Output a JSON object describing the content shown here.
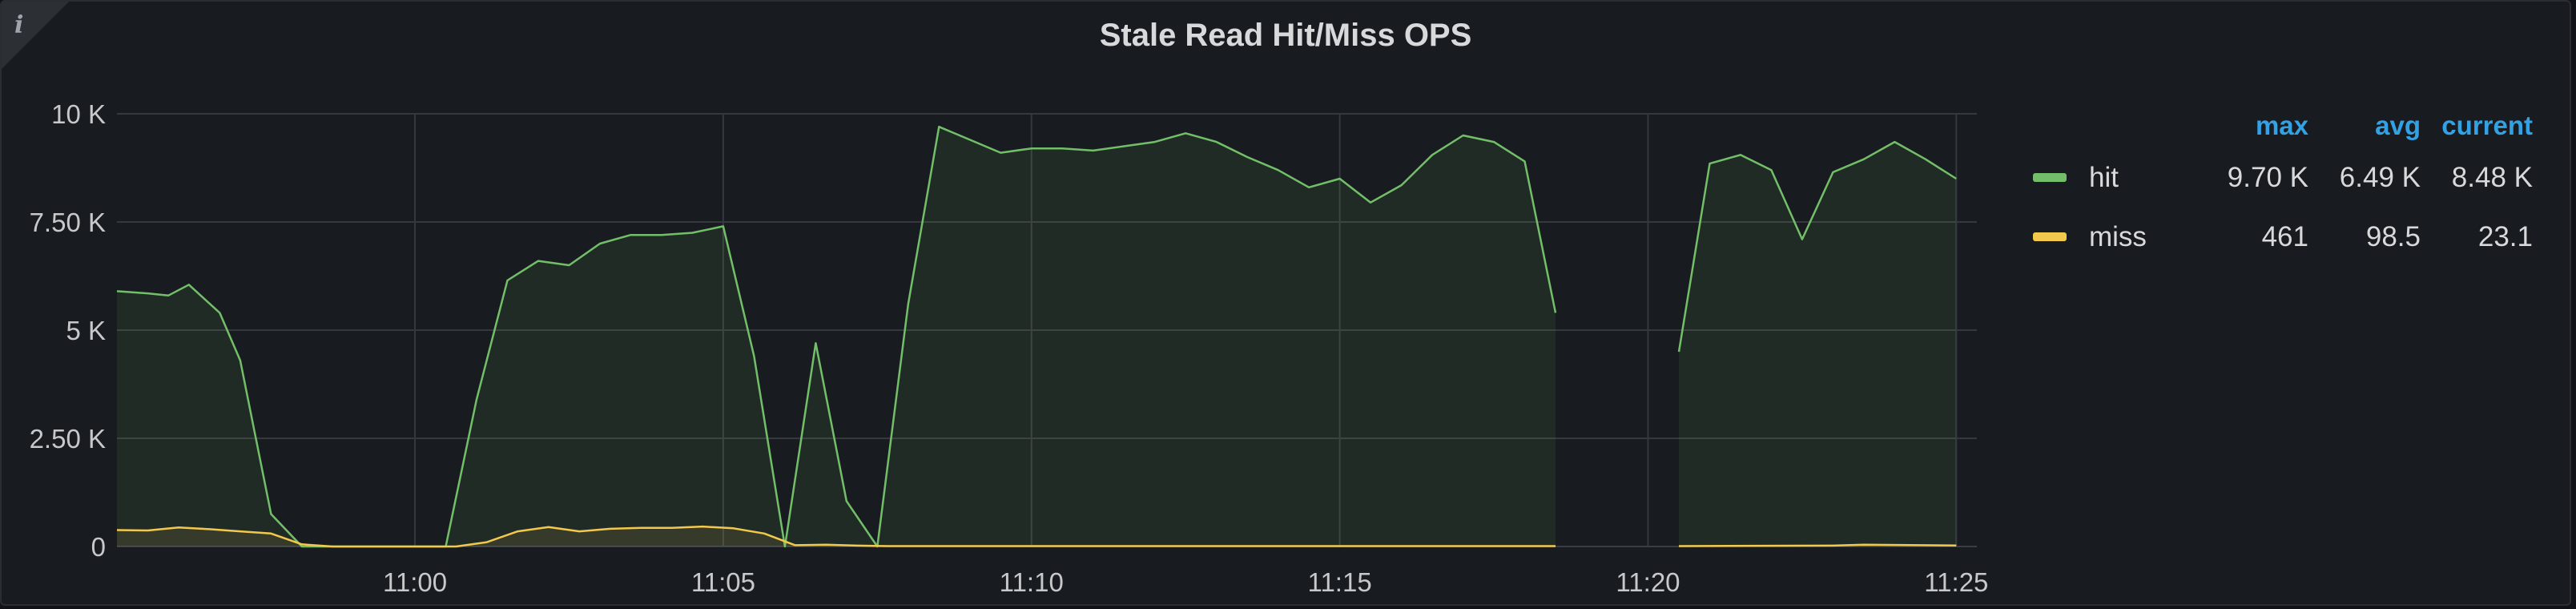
{
  "panel": {
    "info_glyph": "i"
  },
  "chart_data": {
    "type": "area",
    "title": "Stale Read Hit/Miss OPS",
    "x_range": [
      "10:55:10",
      "11:25:20"
    ],
    "x_ticks": [
      "11:00",
      "11:05",
      "11:10",
      "11:15",
      "11:20",
      "11:25"
    ],
    "y_ticks": [
      "0",
      "2.50 K",
      "5 K",
      "7.50 K",
      "10 K"
    ],
    "ylim": [
      0,
      10000
    ],
    "grid": true,
    "legend_placement": "right",
    "legend_columns": [
      "max",
      "avg",
      "current"
    ],
    "series": [
      {
        "name": "hit",
        "color": "#73bf69",
        "stats": {
          "max": "9.70 K",
          "avg": "6.49 K",
          "current": "8.48 K"
        },
        "segments": [
          [
            [
              "10:55:10",
              5900
            ],
            [
              "10:55:40",
              5850
            ],
            [
              "10:56:00",
              5800
            ],
            [
              "10:56:20",
              6050
            ],
            [
              "10:56:50",
              5400
            ],
            [
              "10:57:10",
              4300
            ],
            [
              "10:57:40",
              750
            ],
            [
              "10:58:10",
              0
            ],
            [
              "11:00:30",
              0
            ],
            [
              "11:01:00",
              3400
            ],
            [
              "11:01:30",
              6150
            ],
            [
              "11:02:00",
              6600
            ],
            [
              "11:02:30",
              6500
            ],
            [
              "11:03:00",
              7000
            ],
            [
              "11:03:30",
              7200
            ],
            [
              "11:04:00",
              7200
            ],
            [
              "11:04:30",
              7250
            ],
            [
              "11:05:00",
              7400
            ],
            [
              "11:05:30",
              4400
            ],
            [
              "11:06:00",
              0
            ],
            [
              "11:06:30",
              4700
            ],
            [
              "11:07:00",
              1050
            ],
            [
              "11:07:30",
              0
            ],
            [
              "11:08:00",
              5600
            ],
            [
              "11:08:30",
              9700
            ],
            [
              "11:09:00",
              9400
            ],
            [
              "11:09:30",
              9100
            ],
            [
              "11:10:00",
              9200
            ],
            [
              "11:10:30",
              9200
            ],
            [
              "11:11:00",
              9150
            ],
            [
              "11:11:30",
              9250
            ],
            [
              "11:12:00",
              9350
            ],
            [
              "11:12:30",
              9550
            ],
            [
              "11:13:00",
              9350
            ],
            [
              "11:13:30",
              9000
            ],
            [
              "11:14:00",
              8700
            ],
            [
              "11:14:30",
              8300
            ],
            [
              "11:15:00",
              8500
            ],
            [
              "11:15:30",
              7950
            ],
            [
              "11:16:00",
              8350
            ],
            [
              "11:16:30",
              9050
            ],
            [
              "11:17:00",
              9500
            ],
            [
              "11:17:30",
              9350
            ],
            [
              "11:18:00",
              8900
            ],
            [
              "11:18:30",
              5400
            ]
          ],
          [
            [
              "11:20:30",
              4500
            ],
            [
              "11:21:00",
              8850
            ],
            [
              "11:21:30",
              9050
            ],
            [
              "11:22:00",
              8700
            ],
            [
              "11:22:30",
              7100
            ],
            [
              "11:23:00",
              8650
            ],
            [
              "11:23:30",
              8950
            ],
            [
              "11:24:00",
              9350
            ],
            [
              "11:24:30",
              8950
            ],
            [
              "11:25:00",
              8500
            ]
          ]
        ]
      },
      {
        "name": "miss",
        "color": "#f2c94c",
        "stats": {
          "max": "461",
          "avg": "98.5",
          "current": "23.1"
        },
        "segments": [
          [
            [
              "10:55:10",
              380
            ],
            [
              "10:55:40",
              370
            ],
            [
              "10:56:10",
              440
            ],
            [
              "10:56:40",
              400
            ],
            [
              "10:57:10",
              350
            ],
            [
              "10:57:40",
              300
            ],
            [
              "10:58:10",
              50
            ],
            [
              "10:58:40",
              0
            ],
            [
              "11:00:40",
              0
            ],
            [
              "11:01:10",
              100
            ],
            [
              "11:01:40",
              350
            ],
            [
              "11:02:10",
              450
            ],
            [
              "11:02:40",
              350
            ],
            [
              "11:03:10",
              410
            ],
            [
              "11:03:40",
              430
            ],
            [
              "11:04:10",
              430
            ],
            [
              "11:04:40",
              461
            ],
            [
              "11:05:10",
              420
            ],
            [
              "11:05:40",
              300
            ],
            [
              "11:06:10",
              30
            ],
            [
              "11:06:40",
              40
            ],
            [
              "11:07:10",
              20
            ],
            [
              "11:07:40",
              10
            ],
            [
              "11:18:30",
              10
            ]
          ],
          [
            [
              "11:20:30",
              10
            ],
            [
              "11:23:00",
              20
            ],
            [
              "11:23:30",
              40
            ],
            [
              "11:25:00",
              23.1
            ]
          ]
        ]
      }
    ]
  }
}
